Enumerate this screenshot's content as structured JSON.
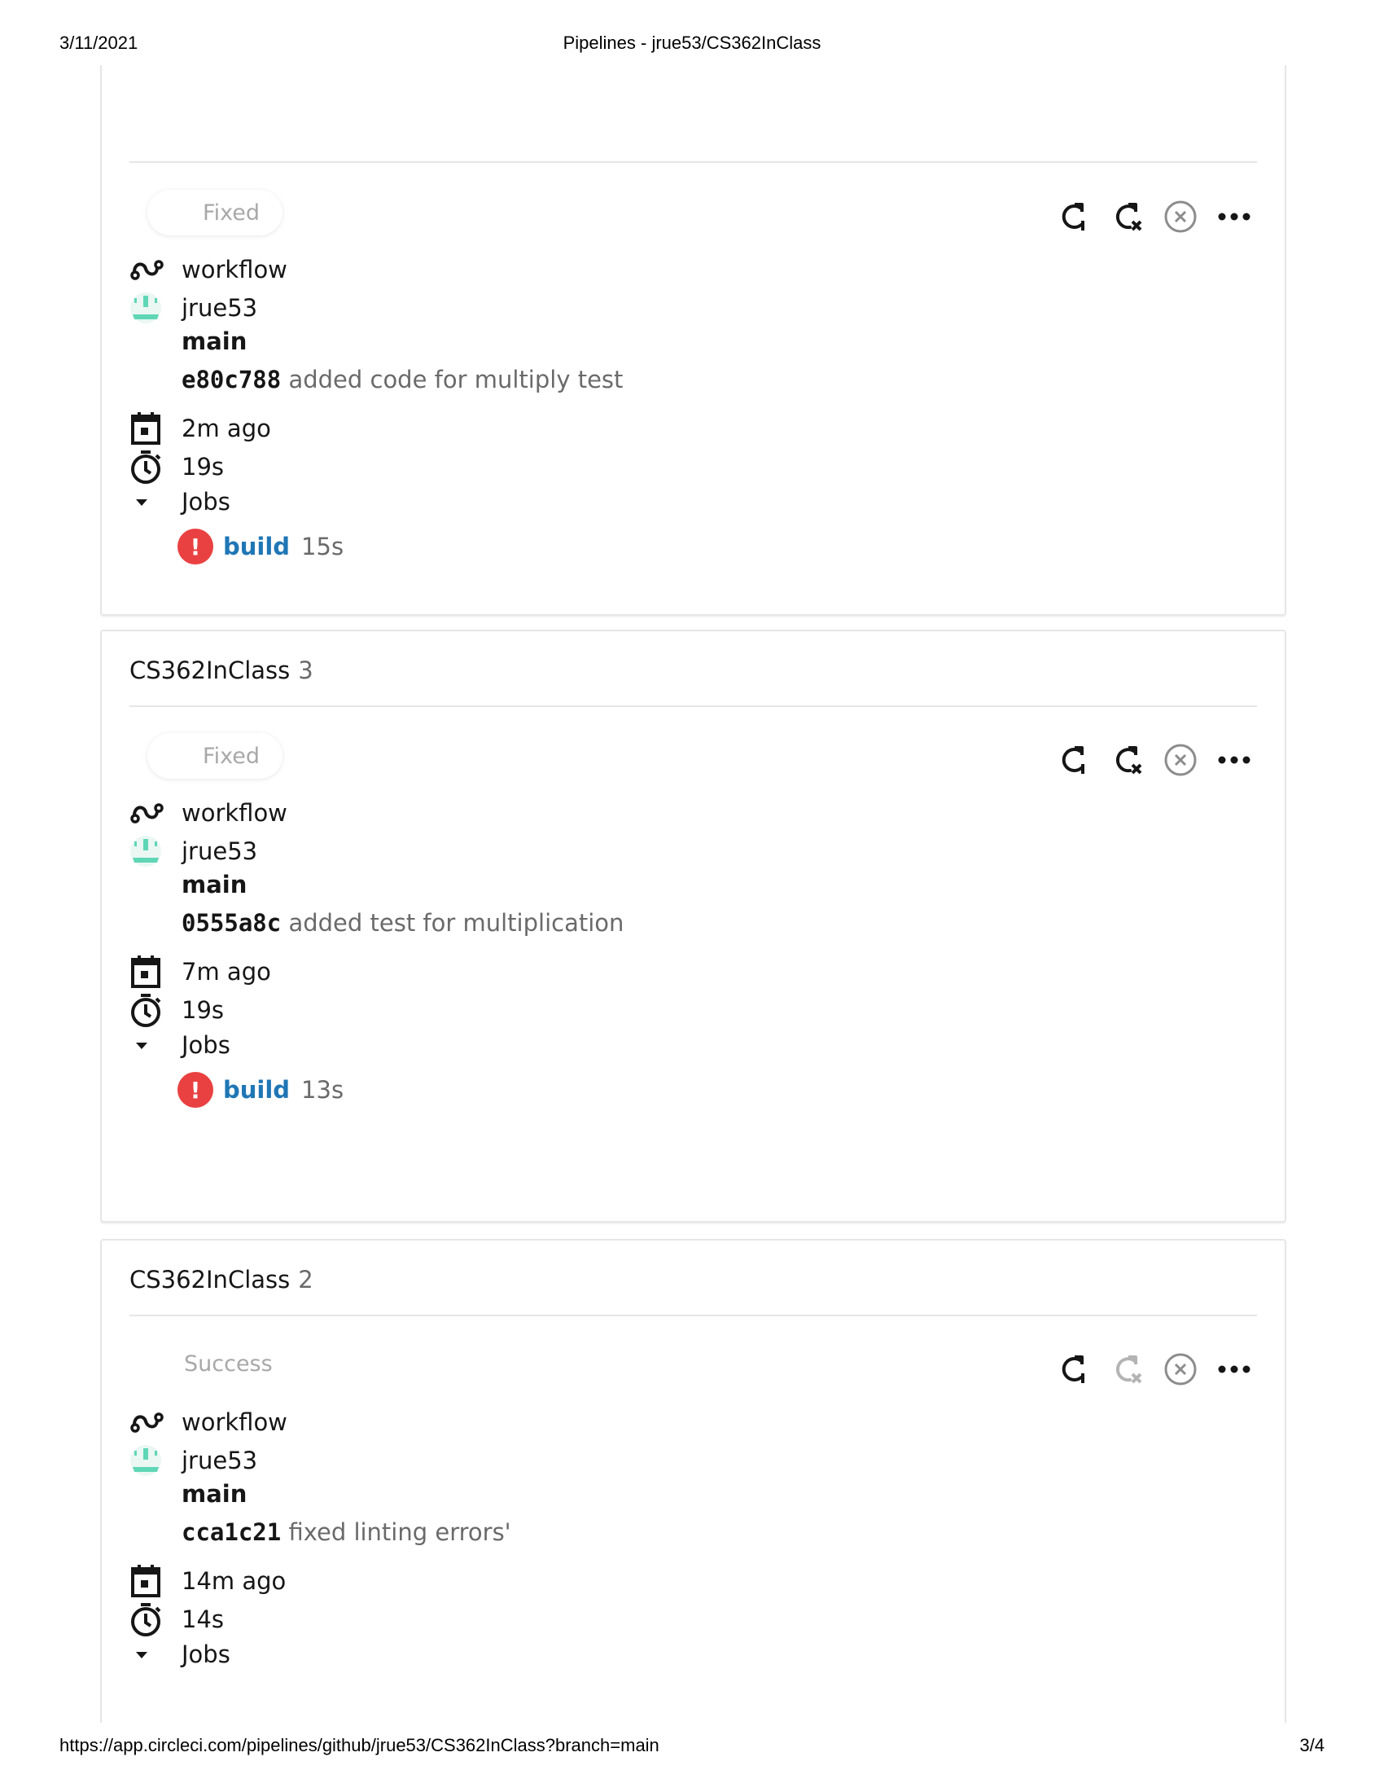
{
  "print": {
    "date": "3/11/2021",
    "page_title": "Pipelines - jrue53/CS362InClass",
    "url": "https://app.circleci.com/pipelines/github/jrue53/CS362InClass?branch=main",
    "page_number": "3/4"
  },
  "icons": {
    "workflow": "workflow-icon",
    "avatar": "avatar-icon",
    "calendar": "calendar-icon",
    "timer": "timer-icon",
    "collapse": "caret-down-icon",
    "rerun": "rerun-icon",
    "rerun_failed": "rerun-failed-icon",
    "cancel": "cancel-icon",
    "more": "more-icon",
    "error": "error-icon"
  },
  "colors": {
    "link": "#1f76b5",
    "error": "#e94141",
    "muted": "#6a6a6a",
    "status": "#a8a8a8",
    "avatar": "#5fd6b5"
  },
  "pipelines": [
    {
      "project": "",
      "number": "",
      "status": "Fixed",
      "workflow": "workflow",
      "user": "jrue53",
      "branch": "main",
      "commit_sha": "e80c788",
      "commit_message": "added code for multiply test",
      "time_ago": "2m ago",
      "duration": "19s",
      "jobs_label": "Jobs",
      "jobs": [
        {
          "status_icon": "!",
          "name": "build",
          "duration": "15s"
        }
      ]
    },
    {
      "project": "CS362InClass",
      "number": "3",
      "status": "Fixed",
      "workflow": "workflow",
      "user": "jrue53",
      "branch": "main",
      "commit_sha": "0555a8c",
      "commit_message": "added test for multiplication",
      "time_ago": "7m ago",
      "duration": "19s",
      "jobs_label": "Jobs",
      "jobs": [
        {
          "status_icon": "!",
          "name": "build",
          "duration": "13s"
        }
      ]
    },
    {
      "project": "CS362InClass",
      "number": "2",
      "status": "Success",
      "workflow": "workflow",
      "user": "jrue53",
      "branch": "main",
      "commit_sha": "cca1c21",
      "commit_message": "fixed linting errors'",
      "time_ago": "14m ago",
      "duration": "14s",
      "jobs_label": "Jobs"
    }
  ]
}
